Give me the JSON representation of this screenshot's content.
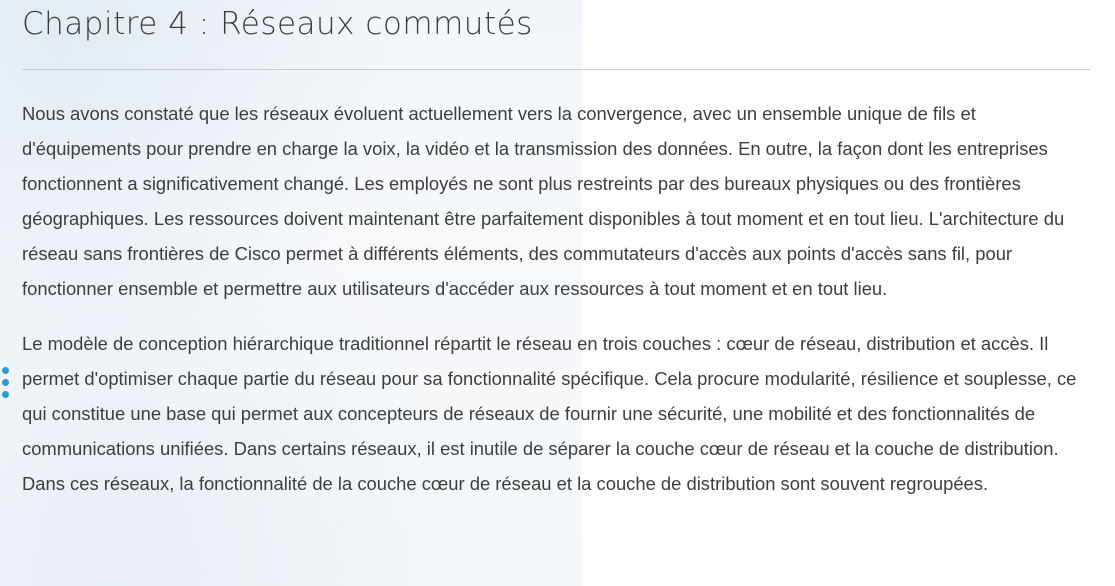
{
  "header": {
    "title": "Chapitre 4 : Réseaux commutés"
  },
  "body": {
    "paragraph_1": "Nous avons constaté que les réseaux évoluent actuellement vers la convergence, avec un ensemble unique de fils et d'équipements pour prendre en charge la voix, la vidéo et la transmission des données. En outre, la façon dont les entreprises fonctionnent a significativement changé. Les employés ne sont plus restreints par des bureaux physiques ou des frontières géographiques. Les ressources doivent maintenant être parfaitement disponibles à tout moment et en tout lieu. L'architecture du réseau sans frontières de Cisco permet à différents éléments, des commutateurs d'accès aux points d'accès sans fil, pour fonctionner ensemble et permettre aux utilisateurs d'accéder aux ressources à tout moment et en tout lieu.",
    "paragraph_2": "Le modèle de conception hiérarchique traditionnel répartit le réseau en trois couches : cœur de réseau, distribution et accès. Il permet d'optimiser chaque partie du réseau pour sa fonctionnalité spécifique. Cela procure modularité, résilience et souplesse, ce qui constitue une base qui permet aux concepteurs de réseaux de fournir une sécurité, une mobilité et des fonctionnalités de communications unifiées. Dans certains réseaux, il est inutile de séparer la couche cœur de réseau et la couche de distribution. Dans ces réseaux, la fonctionnalité de la couche cœur de réseau et la couche de distribution sont souvent regroupées."
  },
  "icons": {
    "side_menu": "vertical-dots-icon"
  },
  "colors": {
    "accent": "#2b9ad8",
    "text": "#3e3e3e",
    "divider": "#c9c9c9"
  }
}
